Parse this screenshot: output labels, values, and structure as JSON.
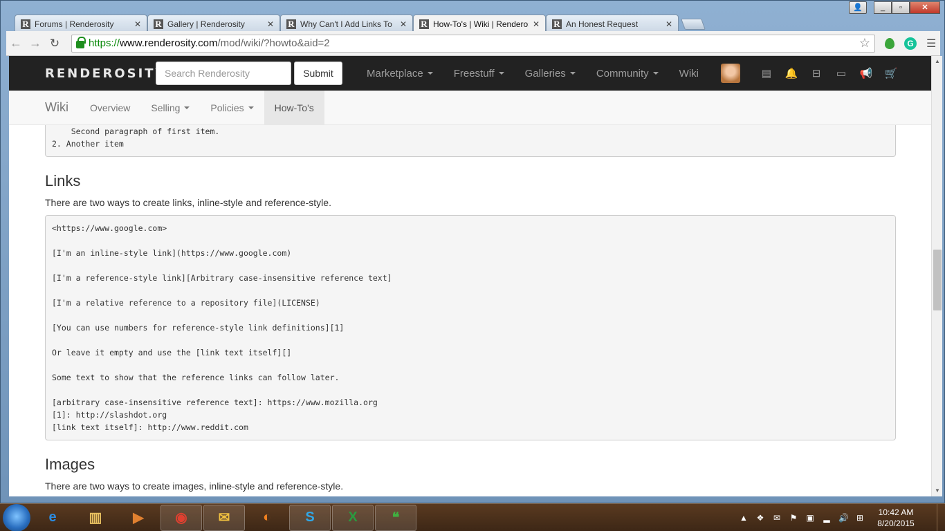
{
  "browser": {
    "tabs": [
      {
        "title": "Forums | Renderosity",
        "active": false
      },
      {
        "title": "Gallery | Renderosity",
        "active": false
      },
      {
        "title": "Why Can't I Add Links To",
        "active": false
      },
      {
        "title": "How-To's | Wiki | Renderosity",
        "active": true
      },
      {
        "title": "An Honest Request",
        "active": false
      }
    ],
    "favicon_letter": "R",
    "close_glyph": "✕",
    "url": {
      "scheme": "https://",
      "host": "www.renderosity.com",
      "path": "/mod/wiki/?howto&aid=2"
    },
    "icons": [
      "back-icon",
      "forward-icon",
      "reload-icon",
      "lock-icon",
      "star-icon",
      "evernote-icon",
      "grammarly-icon",
      "menu-icon"
    ]
  },
  "site": {
    "logo": "RENDEROSITY",
    "search": {
      "placeholder": "Search Renderosity",
      "value": ""
    },
    "submit_label": "Submit",
    "menu": [
      {
        "label": "Marketplace",
        "dropdown": true
      },
      {
        "label": "Freestuff",
        "dropdown": true
      },
      {
        "label": "Galleries",
        "dropdown": true
      },
      {
        "label": "Community",
        "dropdown": true
      },
      {
        "label": "Wiki",
        "dropdown": false
      }
    ],
    "right_icons": [
      "newspaper-icon",
      "bell-icon",
      "inbox-icon",
      "credit-card-icon",
      "megaphone-icon",
      "cart-icon"
    ]
  },
  "subnav": {
    "brand": "Wiki",
    "items": [
      {
        "label": "Overview",
        "dropdown": false,
        "active": false
      },
      {
        "label": "Selling",
        "dropdown": true,
        "active": false
      },
      {
        "label": "Policies",
        "dropdown": true,
        "active": false
      },
      {
        "label": "How-To's",
        "dropdown": false,
        "active": true
      }
    ]
  },
  "content": {
    "prev_code": "    Second paragraph of first item.\n2. Another item",
    "links": {
      "heading": "Links",
      "intro": "There are two ways to create links, inline-style and reference-style.",
      "code": "<https://www.google.com>\n\n[I'm an inline-style link](https://www.google.com)\n\n[I'm a reference-style link][Arbitrary case-insensitive reference text]\n\n[I'm a relative reference to a repository file](LICENSE)\n\n[You can use numbers for reference-style link definitions][1]\n\nOr leave it empty and use the [link text itself][]\n\nSome text to show that the reference links can follow later.\n\n[arbitrary case-insensitive reference text]: https://www.mozilla.org\n[1]: http://slashdot.org\n[link text itself]: http://www.reddit.com"
    },
    "images": {
      "heading": "Images",
      "intro": "There are two ways to create images, inline-style and reference-style."
    }
  },
  "taskbar": {
    "apps": [
      "internet-explorer-icon",
      "file-explorer-icon",
      "media-player-icon",
      "chrome-icon",
      "outlook-icon",
      "firefox-icon",
      "skype-icon",
      "excel-icon",
      "hangouts-icon"
    ],
    "clock": {
      "time": "10:42 AM",
      "date": "8/20/2015"
    }
  }
}
